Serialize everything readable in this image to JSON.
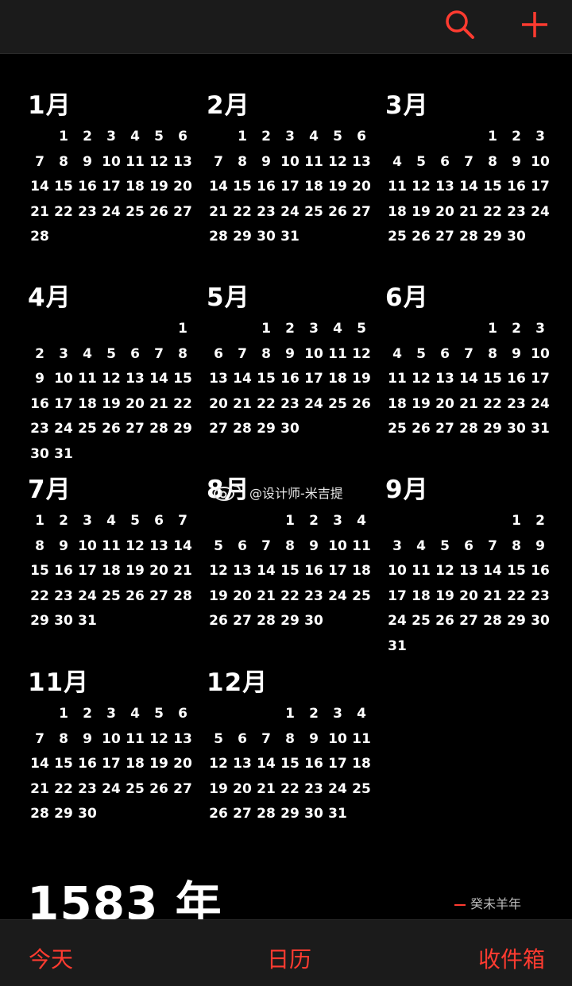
{
  "toolbar": {
    "search_icon": "magnifier-icon",
    "add_icon": "plus-icon",
    "accent": "#ff3b30"
  },
  "months": [
    {
      "label": "1月",
      "offset": 1,
      "days": 28
    },
    {
      "label": "2月",
      "offset": 1,
      "days": 31
    },
    {
      "label": "3月",
      "offset": 4,
      "days": 30
    },
    {
      "label": "4月",
      "offset": 6,
      "days": 31
    },
    {
      "label": "5月",
      "offset": 2,
      "days": 30
    },
    {
      "label": "6月",
      "offset": 4,
      "days": 31
    },
    {
      "label": "7月",
      "offset": 0,
      "days": 31
    },
    {
      "label": "8月",
      "offset": 3,
      "days": 30
    },
    {
      "label": "9月",
      "offset": 5,
      "days": 31
    },
    {
      "label": "11月",
      "offset": 1,
      "days": 30
    },
    {
      "label": "12月",
      "offset": 3,
      "days": 31
    }
  ],
  "watermark": {
    "text": "@设计师-米吉提"
  },
  "next_year": {
    "title": "1583 年",
    "lunar": "癸未羊年"
  },
  "tabs": {
    "today": "今天",
    "calendars": "日历",
    "inbox": "收件箱"
  }
}
